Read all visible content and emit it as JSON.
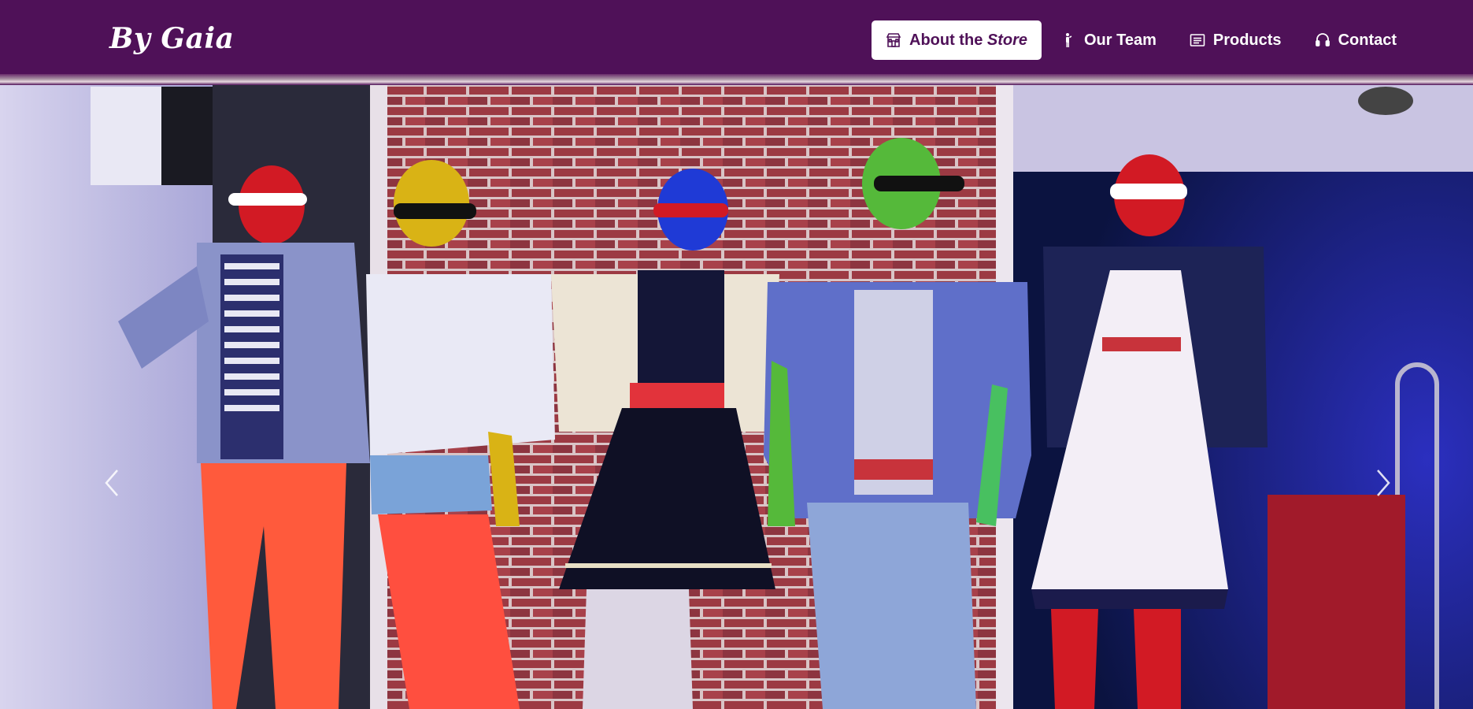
{
  "brand": {
    "name": "By Gaia"
  },
  "nav": {
    "items": [
      {
        "label_main": "About the ",
        "label_em": "Store",
        "icon": "store-icon",
        "active": true
      },
      {
        "label_main": "Our Team",
        "label_em": "",
        "icon": "person-icon",
        "active": false
      },
      {
        "label_main": "Products",
        "label_em": "",
        "icon": "list-icon",
        "active": false
      },
      {
        "label_main": "Contact",
        "label_em": "",
        "icon": "headset-icon",
        "active": false
      }
    ]
  },
  "carousel": {
    "prev_icon": "chevron-left-icon",
    "next_icon": "chevron-right-icon"
  },
  "colors": {
    "navbar": "#4f1158",
    "active_bg": "#ffffff",
    "active_text": "#4f1158"
  }
}
